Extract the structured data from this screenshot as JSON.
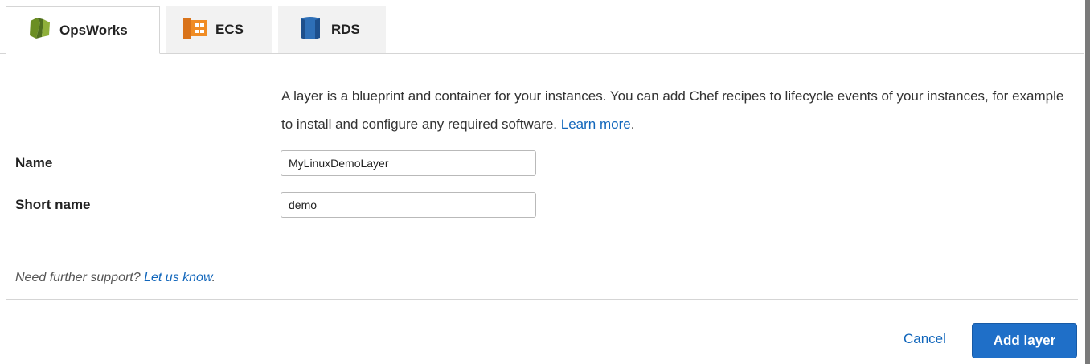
{
  "tabs": [
    {
      "label": "OpsWorks",
      "icon": "opsworks-icon",
      "active": true
    },
    {
      "label": "ECS",
      "icon": "ecs-icon",
      "active": false
    },
    {
      "label": "RDS",
      "icon": "rds-icon",
      "active": false
    }
  ],
  "description": {
    "text": "A layer is a blueprint and container for your instances. You can add Chef recipes to lifecycle events of your instances, for example to install and configure any required software.",
    "link": "Learn more"
  },
  "form": {
    "name_label": "Name",
    "name_value": "MyLinuxDemoLayer",
    "short_name_label": "Short name",
    "short_name_value": "demo"
  },
  "support": {
    "text": "Need further support?",
    "link": "Let us know"
  },
  "actions": {
    "cancel": "Cancel",
    "add": "Add layer"
  },
  "colors": {
    "link": "#1166bb",
    "primary_button": "#1f6fc8",
    "opsworks_green": "#4f6f1f",
    "ecs_orange": "#e8821c",
    "rds_blue": "#2e6fb7"
  }
}
